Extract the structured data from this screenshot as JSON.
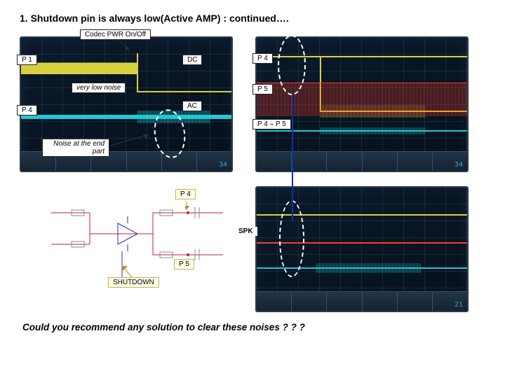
{
  "title": "1. Shutdown pin is always low(Active AMP) : continued….",
  "labels": {
    "codec": "Codec PWR On/Off",
    "p1": "P 1",
    "p4_left": "P 4",
    "dc": "DC",
    "ac": "AC",
    "very_low_noise": "very low noise",
    "noise_end": "Noise at the end part",
    "p4_right": "P 4",
    "p5_right": "P 5",
    "p4_p5": "P 4 – P 5",
    "p4_schem": "P 4",
    "p5_schem": "P 5",
    "spk": "SPK",
    "shutdown": "SHUTDOWN"
  },
  "scope_readout": {
    "left": "34",
    "right_top": "34",
    "right_bottom": "21"
  },
  "question": "Could you recommend any solution to clear these noises ? ? ?"
}
